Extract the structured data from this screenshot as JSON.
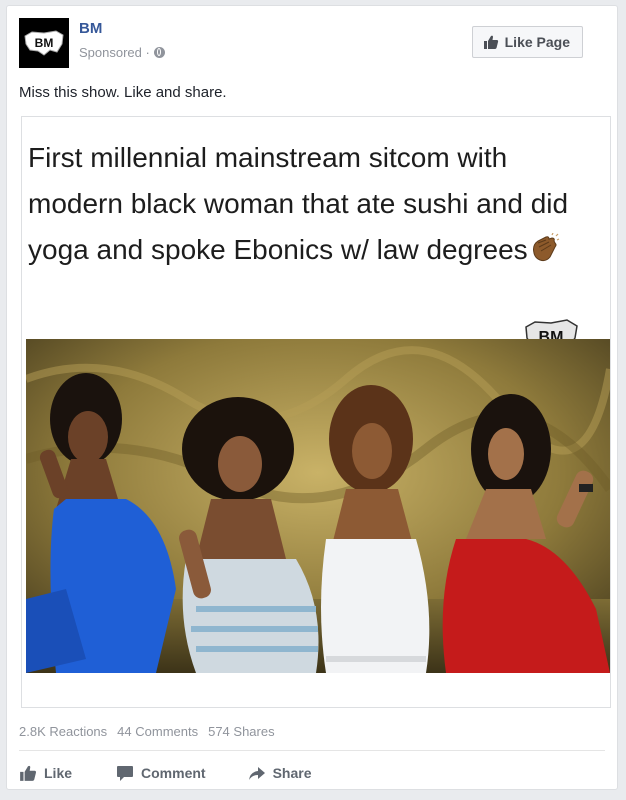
{
  "post": {
    "page_name": "BM",
    "avatar_text": "BM",
    "sponsored_label": "Sponsored ·",
    "like_page_label": "Like Page",
    "message": "Miss this show. Like and share."
  },
  "shared_image": {
    "caption": "First millennial mainstream sitcom with modern black woman that ate sushi and did yoga and spoke Ebonics w/ law degrees",
    "watermark": "BM"
  },
  "stats": {
    "reactions": "2.8K Reactions",
    "comments": "44 Comments",
    "shares": "574 Shares"
  },
  "actions": {
    "like": "Like",
    "comment": "Comment",
    "share": "Share"
  },
  "icons": {
    "like": "thumbs-up-icon",
    "comment": "speech-bubble-icon",
    "share": "share-arrow-icon",
    "privacy": "globe-icon"
  }
}
